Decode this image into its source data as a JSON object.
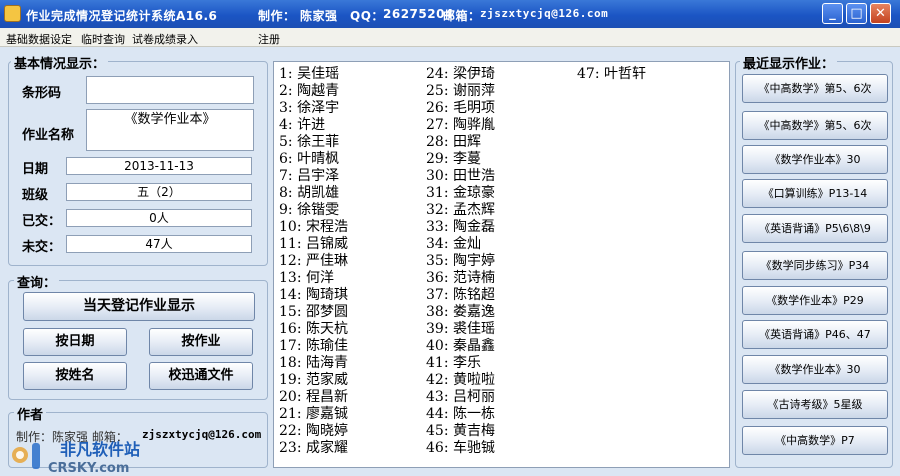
{
  "titlebar": {
    "title": "作业完成情况登记统计系统A16.6",
    "author_label": "制作：",
    "author": "陈家强",
    "qq_label": "QQ：",
    "qq": "26275204",
    "email_label": "邮箱：",
    "email": "zjszxtycjq@126.com",
    "min": "_",
    "max": "□",
    "close": "✕"
  },
  "menu": [
    "基础数据设定",
    "临时查询",
    "试卷成绩录入",
    "注册"
  ],
  "basic": {
    "title": "基本情况显示：",
    "barcode_label": "条形码",
    "barcode_value": "",
    "homework_label": "作业名称",
    "homework_value": "《数学作业本》",
    "date_label": "日期",
    "date_value": "2013-11-13",
    "class_label": "班级",
    "class_value": "五（2）",
    "submitted_label": "已交：",
    "submitted_value": "0人",
    "unsubmitted_label": "未交：",
    "unsubmitted_value": "47人"
  },
  "query": {
    "title": "查询：",
    "today_btn": "当天登记作业显示",
    "by_date": "按日期",
    "by_homework": "按作业",
    "by_name": "按姓名",
    "school_file": "校迅通文件"
  },
  "author_box": {
    "title": "作者",
    "line": "制作：陈家强   邮箱：",
    "email": "zjszxtycjq@126.com"
  },
  "students": {
    "col1": [
      "1: 吴佳瑶",
      "2: 陶越青",
      "3: 徐泽宇",
      "4: 许进",
      "5: 徐王菲",
      "6: 叶晴枫",
      "7: 吕宇泽",
      "8: 胡凯雄",
      "9: 徐锴雯",
      "10: 宋程浩",
      "11: 吕锦威",
      "12: 严佳琳",
      "13: 何洋",
      "14: 陶琦琪",
      "15: 邵梦圆",
      "16: 陈天杭",
      "17: 陈瑜佳",
      "18: 陆海青",
      "19: 范家威",
      "20: 程昌新",
      "21: 廖嘉铖",
      "22: 陶晓婷",
      "23: 成家耀"
    ],
    "col2": [
      "24: 梁伊琦",
      "25: 谢丽萍",
      "26: 毛明项",
      "27: 陶骅胤",
      "28: 田辉",
      "29: 李蔓",
      "30: 田世浩",
      "31: 金琼豪",
      "32: 孟杰辉",
      "33: 陶金磊",
      "34: 金灿",
      "35: 陶宇婷",
      "36: 范诗楠",
      "37: 陈铭超",
      "38: 娄嘉逸",
      "39: 裘佳瑶",
      "40: 秦晶鑫",
      "41: 李乐",
      "42: 黄啦啦",
      "43: 吕柯丽",
      "44: 陈一栋",
      "45: 黄吉梅",
      "46: 车驰铖"
    ],
    "col3": [
      "47: 叶哲轩"
    ]
  },
  "recent": {
    "title": "最近显示作业：",
    "items": [
      "《中高数学》第5、6次",
      "《中高数学》第5、6次",
      "《数学作业本》30",
      "《口算训练》P13-14",
      "《英语背诵》P5\\6\\8\\9",
      "《数学同步练习》P34",
      "《数学作业本》P29",
      "《英语背诵》P46、47",
      "《数学作业本》30",
      "《古诗考级》5星级",
      "《中高数学》P7"
    ]
  },
  "watermark": {
    "cn": "非凡软件站",
    "en": "CRSKY.com"
  }
}
